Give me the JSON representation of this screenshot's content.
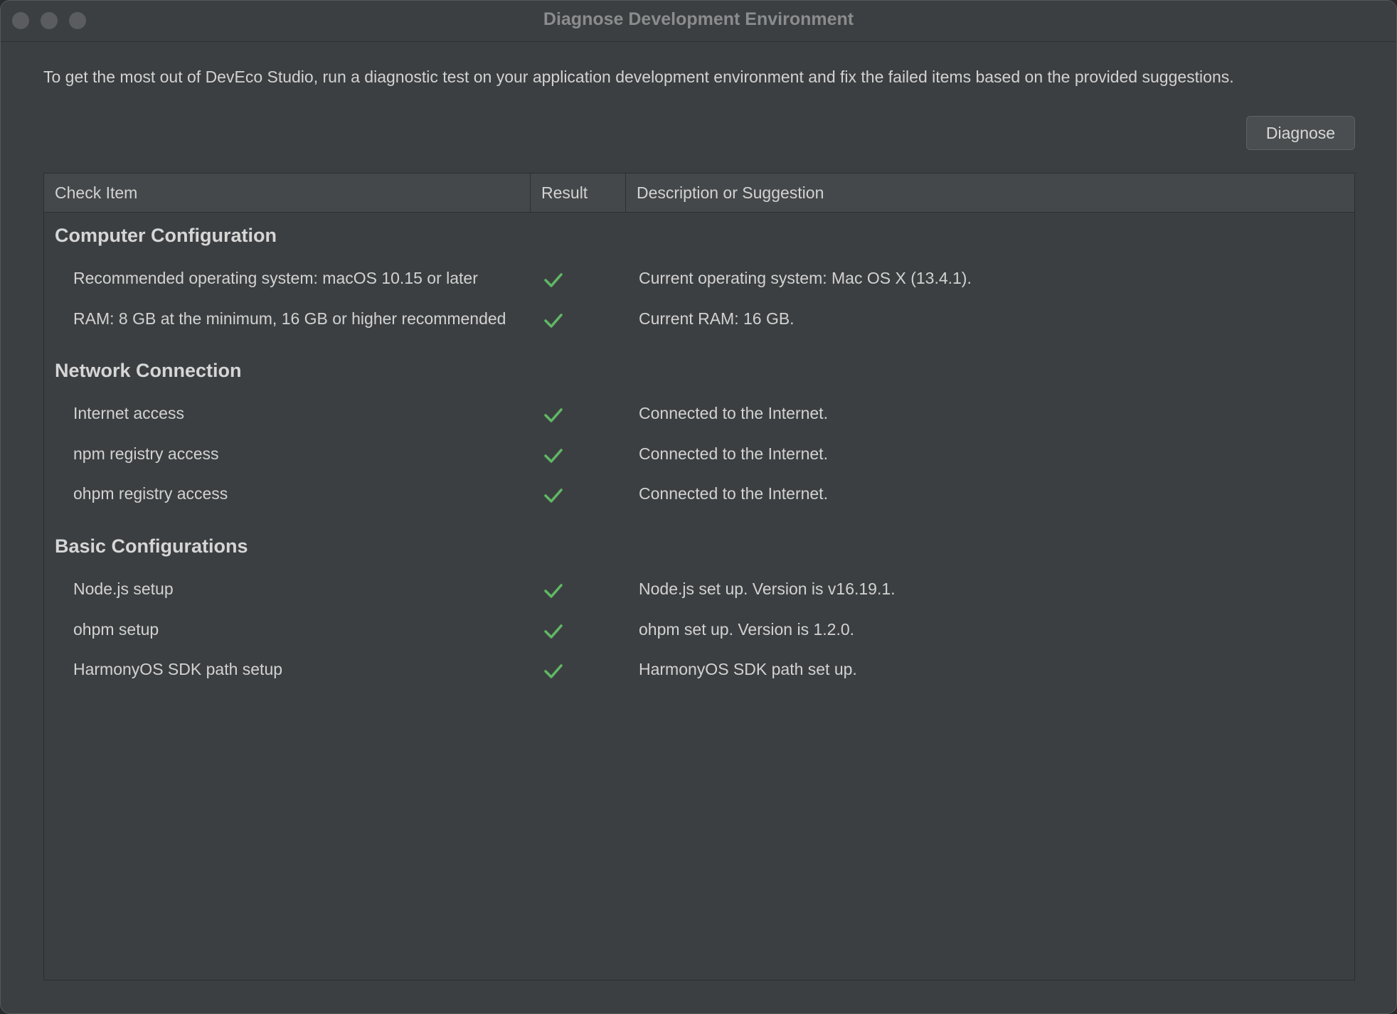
{
  "window": {
    "title": "Diagnose Development Environment"
  },
  "intro_text": "To get the most out of DevEco Studio, run a diagnostic test on your application development environment and fix the failed items based on the provided suggestions.",
  "diagnose_button": "Diagnose",
  "table": {
    "headers": [
      "Check Item",
      "Result",
      "Description or Suggestion"
    ],
    "groups": [
      {
        "title": "Computer Configuration",
        "rows": [
          {
            "item": "Recommended operating system: macOS 10.15 or later",
            "result": "check-icon",
            "desc": "Current operating system: Mac OS X (13.4.1)."
          },
          {
            "item": "RAM: 8 GB at the minimum, 16 GB or higher recommended",
            "result": "check-icon",
            "desc": "Current RAM: 16 GB."
          }
        ]
      },
      {
        "title": "Network Connection",
        "rows": [
          {
            "item": "Internet access",
            "result": "check-icon",
            "desc": "Connected to the Internet."
          },
          {
            "item": "npm registry access",
            "result": "check-icon",
            "desc": "Connected to the Internet."
          },
          {
            "item": "ohpm registry access",
            "result": "check-icon",
            "desc": "Connected to the Internet."
          }
        ]
      },
      {
        "title": "Basic Configurations",
        "rows": [
          {
            "item": "Node.js setup",
            "result": "check-icon",
            "desc": "Node.js set up. Version is v16.19.1."
          },
          {
            "item": "ohpm setup",
            "result": "check-icon",
            "desc": "ohpm set up. Version is 1.2.0."
          },
          {
            "item": "HarmonyOS SDK path setup",
            "result": "check-icon",
            "desc": "HarmonyOS SDK path set up."
          }
        ]
      }
    ]
  },
  "colors": {
    "check": "#5fb865",
    "background": "#3c3f41",
    "header": "#45484a"
  }
}
